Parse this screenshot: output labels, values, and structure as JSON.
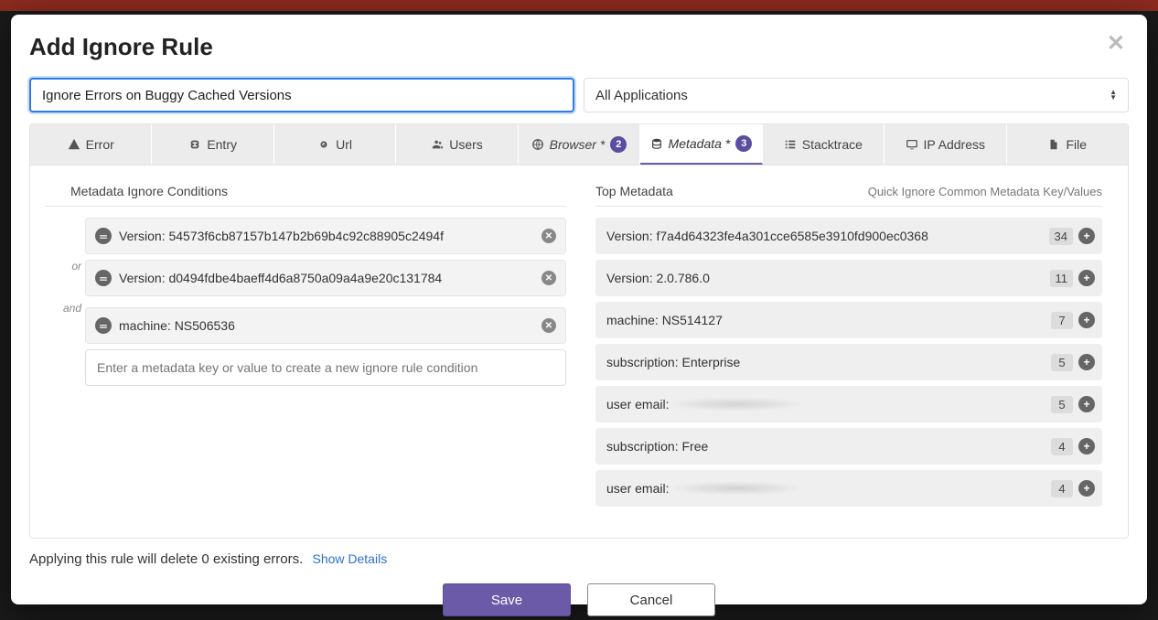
{
  "modal": {
    "title": "Add Ignore Rule",
    "rule_name": "Ignore Errors on Buggy Cached Versions",
    "app_select": "All Applications"
  },
  "tabs": {
    "error": {
      "label": "Error"
    },
    "entry": {
      "label": "Entry"
    },
    "url": {
      "label": "Url"
    },
    "users": {
      "label": "Users"
    },
    "browser": {
      "label": "Browser *",
      "count": "2"
    },
    "metadata": {
      "label": "Metadata *",
      "count": "3"
    },
    "stacktrace": {
      "label": "Stacktrace"
    },
    "ip": {
      "label": "IP Address"
    },
    "file": {
      "label": "File"
    }
  },
  "conditions": {
    "title": "Metadata Ignore Conditions",
    "connector_or": "or",
    "connector_and": "and",
    "items": [
      {
        "text": "Version: 54573f6cb87157b147b2b69b4c92c88905c2494f"
      },
      {
        "text": "Version: d0494fdbe4baeff4d6a8750a09a4a9e20c131784"
      },
      {
        "text": "machine: NS506536"
      }
    ],
    "placeholder": "Enter a metadata key or value to create a new ignore rule condition"
  },
  "top_metadata": {
    "title": "Top Metadata",
    "subtitle": "Quick Ignore Common Metadata Key/Values",
    "rows": [
      {
        "label": "Version: f7a4d64323fe4a301cce6585e3910fd900ec0368",
        "count": "34",
        "redacted": false
      },
      {
        "label": "Version: 2.0.786.0",
        "count": "11",
        "redacted": false
      },
      {
        "label": "machine: NS514127",
        "count": "7",
        "redacted": false
      },
      {
        "label": "subscription: Enterprise",
        "count": "5",
        "redacted": false
      },
      {
        "label": "user email:",
        "count": "5",
        "redacted": true
      },
      {
        "label": "subscription: Free",
        "count": "4",
        "redacted": false
      },
      {
        "label": "user email:",
        "count": "4",
        "redacted": true
      }
    ]
  },
  "footer": {
    "summary": "Applying this rule will delete 0 existing errors.",
    "details_link": "Show Details",
    "save": "Save",
    "cancel": "Cancel"
  }
}
